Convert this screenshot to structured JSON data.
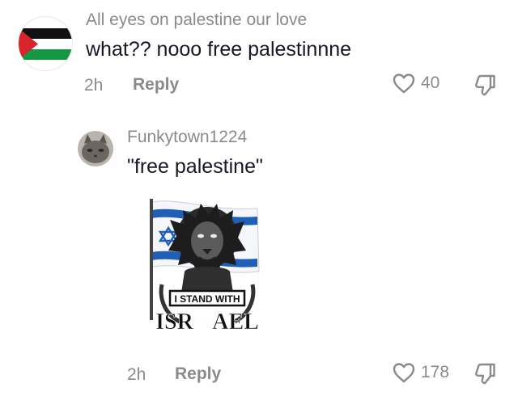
{
  "comments": [
    {
      "username": "All eyes on palestine our love",
      "text": "what?? nooo free palestinnne",
      "time": "2h",
      "reply_label": "Reply",
      "likes": "40",
      "avatar": "palestine-flag"
    },
    {
      "username": "Funkytown1224",
      "text": "\"free palestine\"",
      "time": "2h",
      "reply_label": "Reply",
      "likes": "178",
      "avatar": "cat-photo",
      "sticker": {
        "line1": "I STAND WITH",
        "line2": "ISR✡AEL"
      }
    }
  ],
  "colors": {
    "text": "#161823",
    "secondary": "#8a8a8a",
    "israel_blue": "#1f5fb8"
  }
}
